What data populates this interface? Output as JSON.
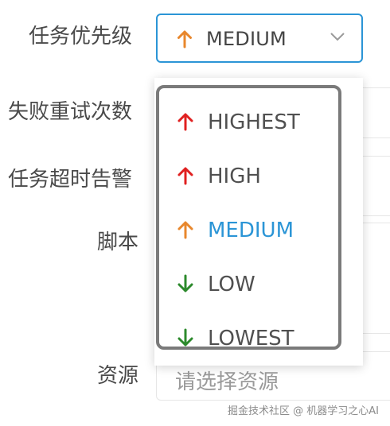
{
  "form": {
    "labels": {
      "priority": "任务优先级",
      "retry": "失败重试次数",
      "timeout": "任务超时告警",
      "script": "脚本",
      "resource": "资源"
    },
    "resource_placeholder": "请选择资源"
  },
  "priority_select": {
    "selected_value": "MEDIUM",
    "selected_icon": "arrow-up-icon",
    "options": [
      {
        "label": "HIGHEST",
        "icon": "arrow-up-icon",
        "color": "#e02020",
        "selected": false
      },
      {
        "label": "HIGH",
        "icon": "arrow-up-icon",
        "color": "#e02020",
        "selected": false
      },
      {
        "label": "MEDIUM",
        "icon": "arrow-up-icon",
        "color": "#e8872c",
        "selected": true
      },
      {
        "label": "LOW",
        "icon": "arrow-down-icon",
        "color": "#2c8a2c",
        "selected": false
      },
      {
        "label": "LOWEST",
        "icon": "arrow-down-icon",
        "color": "#2c8a2c",
        "selected": false
      }
    ]
  },
  "colors": {
    "accent": "#2b95d6",
    "highest": "#e02020",
    "medium": "#e8872c",
    "low": "#2c8a2c"
  },
  "watermark": "掘金技术社区 @ 机器学习之心AI"
}
